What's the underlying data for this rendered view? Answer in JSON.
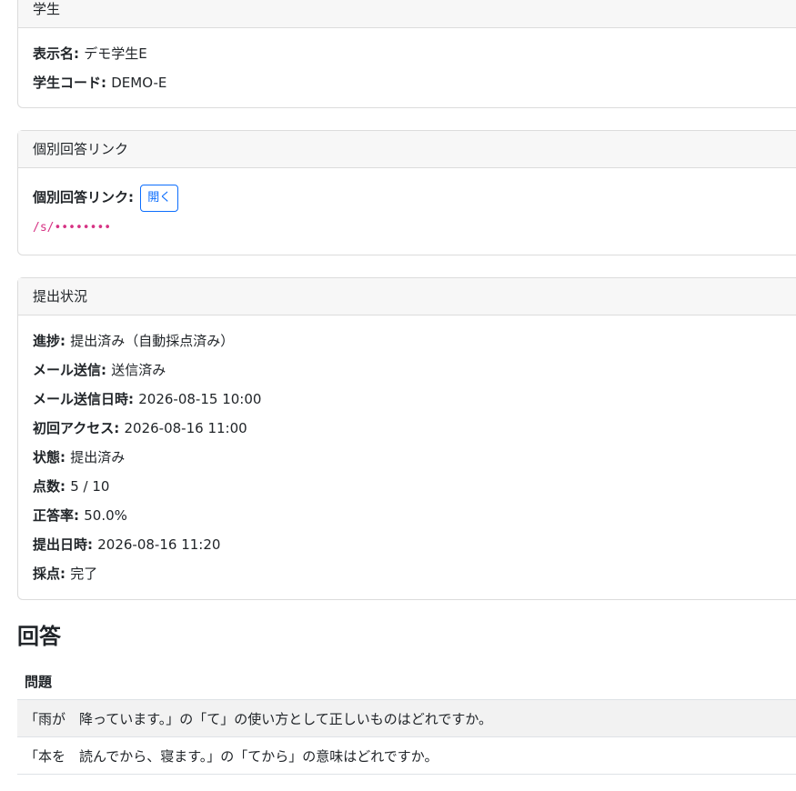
{
  "student_card": {
    "header": "学生",
    "display_name_label": "表示名",
    "display_name_value": "デモ学生E",
    "student_code_label": "学生コード",
    "student_code_value": "DEMO-E"
  },
  "link_card": {
    "header": "個別回答リンク",
    "link_label": "個別回答リンク",
    "open_button": "開く",
    "link_path": "/s/••••••••"
  },
  "status_card": {
    "header": "提出状況",
    "rows": [
      {
        "label": "進捗",
        "value": "提出済み（自動採点済み）"
      },
      {
        "label": "メール送信",
        "value": "送信済み"
      },
      {
        "label": "メール送信日時",
        "value": "2026-08-15 10:00"
      },
      {
        "label": "初回アクセス",
        "value": "2026-08-16 11:00"
      },
      {
        "label": "状態",
        "value": "提出済み"
      },
      {
        "label": "点数",
        "value": "5 / 10"
      },
      {
        "label": "正答率",
        "value": "50.0%"
      },
      {
        "label": "提出日時",
        "value": "2026-08-16 11:20"
      },
      {
        "label": "採点",
        "value": "完了"
      }
    ]
  },
  "answers": {
    "heading": "回答",
    "column_question": "問題",
    "questions": [
      "「雨が　降っています。」の「て」の使い方として正しいものはどれですか。",
      "「本を　読んでから、寝ます。」の「てから」の意味はどれですか。"
    ]
  }
}
